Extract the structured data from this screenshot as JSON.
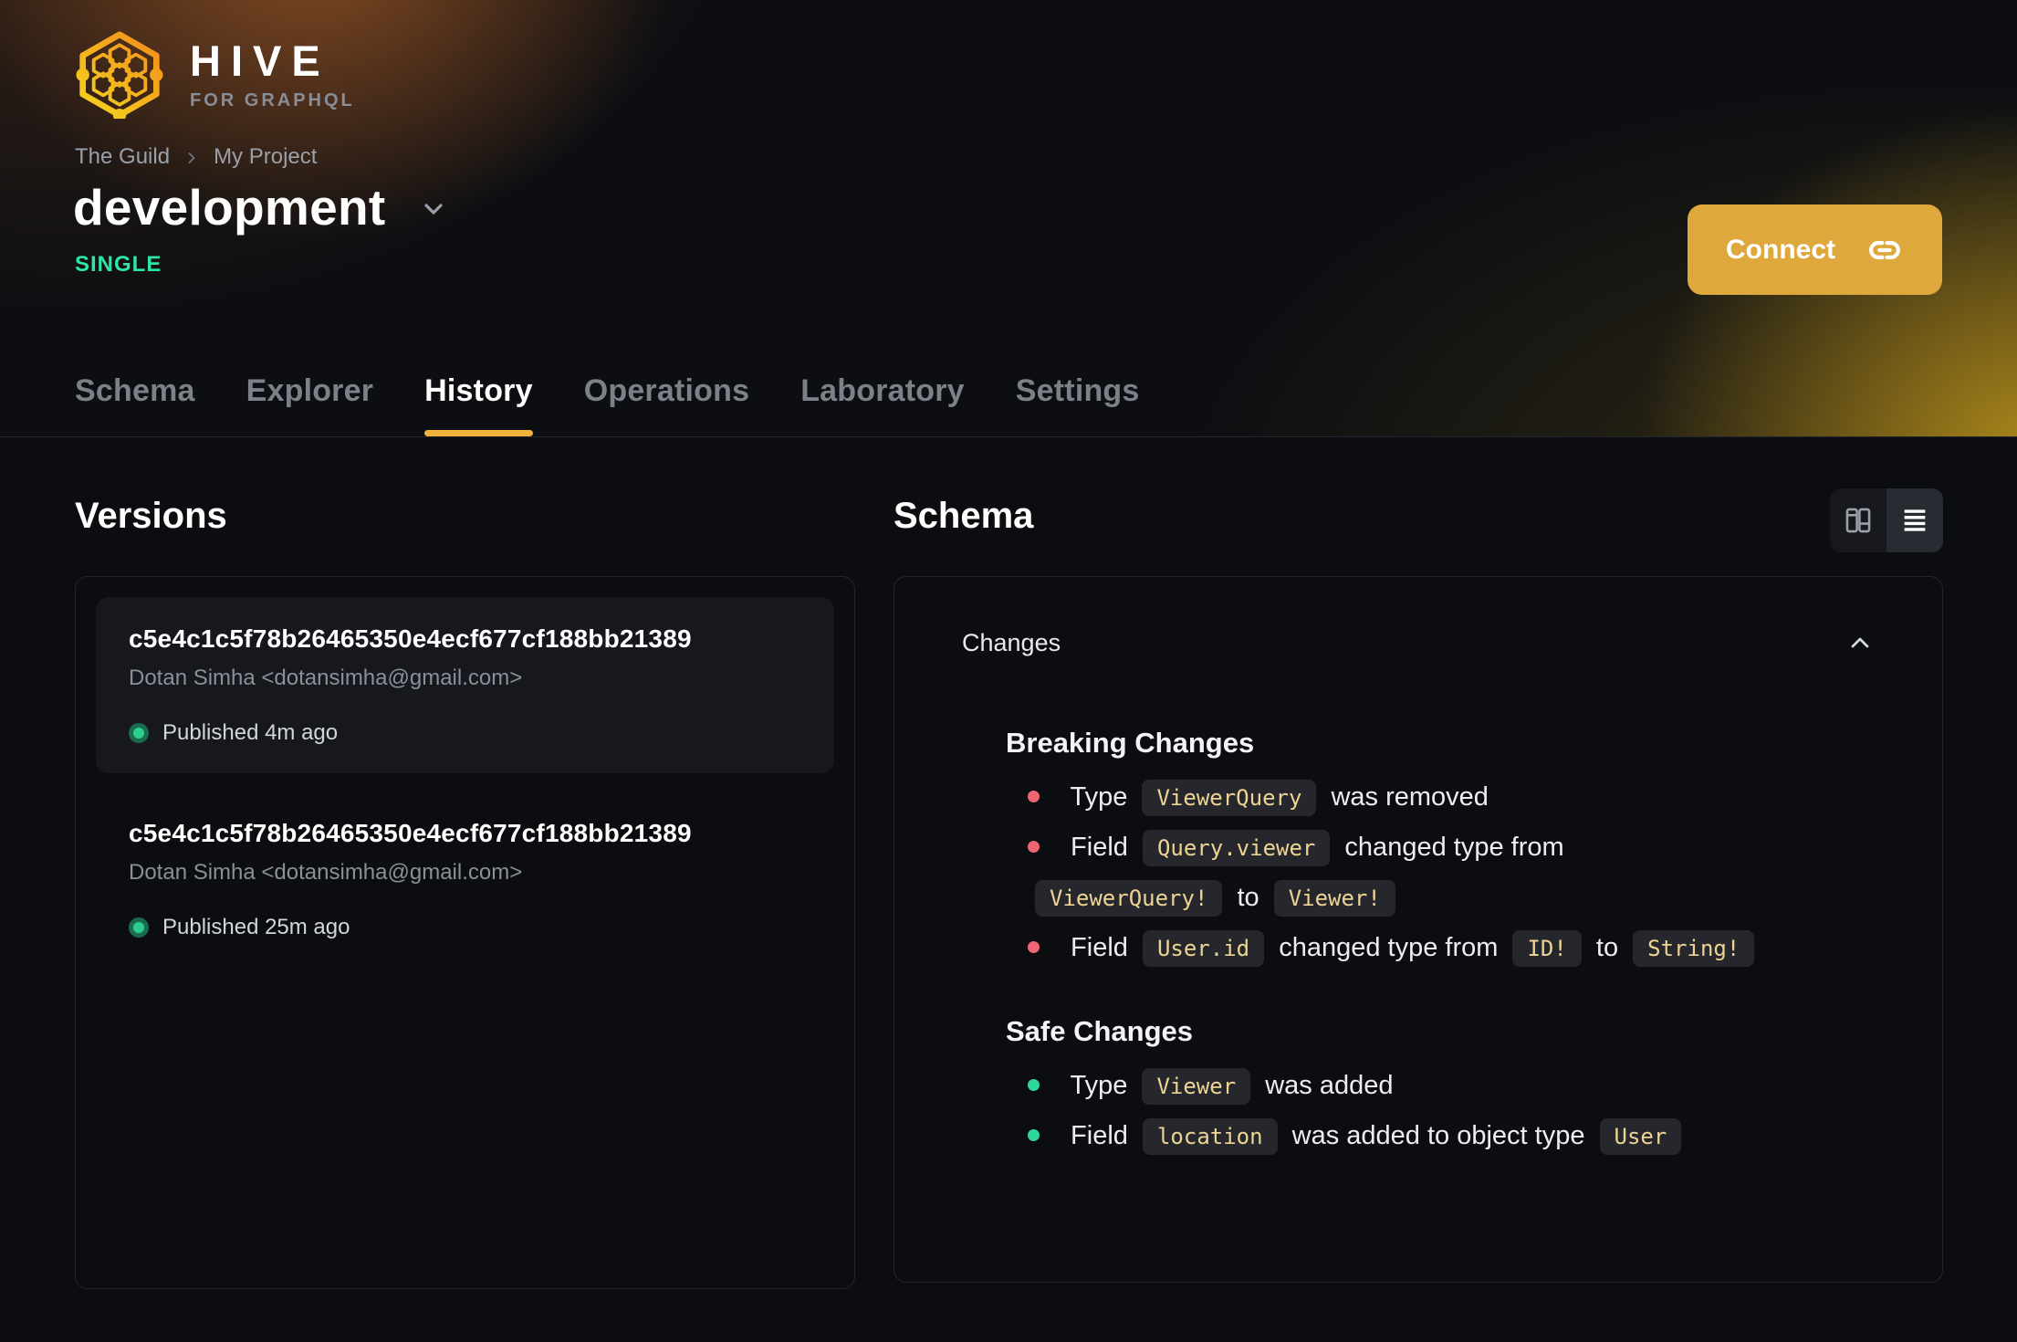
{
  "colors": {
    "accent": "#dfa83d",
    "tab_underline": "#f2b33d",
    "env_badge": "#2ee5a9",
    "breaking_bullet": "#ee6673",
    "safe_bullet": "#2fd79a",
    "chip_bg": "#25272d",
    "chip_text": "#eed494",
    "status_dot_inner": "#2bd08f",
    "status_dot_ring": "#1b6b4f"
  },
  "logo": {
    "title": "HIVE",
    "subtitle": "FOR GRAPHQL"
  },
  "breadcrumb": {
    "items": [
      "The Guild",
      "My Project"
    ]
  },
  "target": {
    "name": "development",
    "env_badge": "SINGLE"
  },
  "connect": {
    "label": "Connect"
  },
  "tabs": {
    "items": [
      {
        "label": "Schema",
        "active": false
      },
      {
        "label": "Explorer",
        "active": false
      },
      {
        "label": "History",
        "active": true
      },
      {
        "label": "Operations",
        "active": false
      },
      {
        "label": "Laboratory",
        "active": false
      },
      {
        "label": "Settings",
        "active": false
      }
    ]
  },
  "versions": {
    "heading": "Versions",
    "items": [
      {
        "hash": "c5e4c1c5f78b26465350e4ecf677cf188bb21389",
        "author": "Dotan Simha <dotansimha@gmail.com>",
        "status": "Published 4m ago",
        "selected": true
      },
      {
        "hash": "c5e4c1c5f78b26465350e4ecf677cf188bb21389",
        "author": "Dotan Simha <dotansimha@gmail.com>",
        "status": "Published 25m ago",
        "selected": false
      }
    ]
  },
  "schema_panel": {
    "heading": "Schema",
    "view_toggle": {
      "options": [
        "columns",
        "list"
      ],
      "active": "list"
    },
    "changes": {
      "label": "Changes",
      "collapsed": false,
      "sections": [
        {
          "title": "Breaking Changes",
          "kind": "breaking",
          "items": [
            [
              {
                "t": "text",
                "v": "Type"
              },
              {
                "t": "code",
                "v": "ViewerQuery"
              },
              {
                "t": "text",
                "v": "was removed"
              }
            ],
            [
              {
                "t": "text",
                "v": "Field"
              },
              {
                "t": "code",
                "v": "Query.viewer"
              },
              {
                "t": "text",
                "v": "changed type from"
              },
              {
                "t": "code",
                "v": "ViewerQuery!"
              },
              {
                "t": "text",
                "v": "to",
                "keep_with_next": true
              },
              {
                "t": "code",
                "v": "Viewer!"
              }
            ],
            [
              {
                "t": "text",
                "v": "Field"
              },
              {
                "t": "code",
                "v": "User.id"
              },
              {
                "t": "text",
                "v": "changed type from"
              },
              {
                "t": "code",
                "v": "ID!"
              },
              {
                "t": "text",
                "v": "to"
              },
              {
                "t": "code",
                "v": "String!"
              }
            ]
          ]
        },
        {
          "title": "Safe Changes",
          "kind": "safe",
          "items": [
            [
              {
                "t": "text",
                "v": "Type"
              },
              {
                "t": "code",
                "v": "Viewer"
              },
              {
                "t": "text",
                "v": "was added"
              }
            ],
            [
              {
                "t": "text",
                "v": "Field"
              },
              {
                "t": "code",
                "v": "location"
              },
              {
                "t": "text",
                "v": "was added to object type"
              },
              {
                "t": "code",
                "v": "User"
              }
            ]
          ]
        }
      ]
    }
  }
}
